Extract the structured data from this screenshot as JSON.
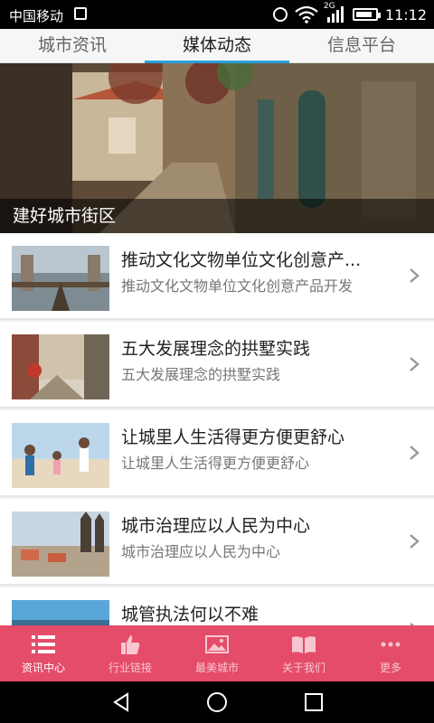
{
  "status": {
    "carrier": "中国移动",
    "network": "2G",
    "time": "11:12",
    "battery_level": 0.85
  },
  "tabs": [
    {
      "label": "城市资讯",
      "active": false
    },
    {
      "label": "媒体动态",
      "active": true
    },
    {
      "label": "信息平台",
      "active": false
    }
  ],
  "banner": {
    "caption": "建好城市街区"
  },
  "news": [
    {
      "title": "推动文化文物单位文化创意产...",
      "desc": "推动文化文物单位文化创意产品开发"
    },
    {
      "title": "五大发展理念的拱墅实践",
      "desc": "五大发展理念的拱墅实践"
    },
    {
      "title": "让城里人生活得更方便更舒心",
      "desc": "让城里人生活得更方便更舒心"
    },
    {
      "title": "城市治理应以人民为中心",
      "desc": "城市治理应以人民为中心"
    },
    {
      "title": "城管执法何以不难",
      "desc": ""
    }
  ],
  "bottom_nav": [
    {
      "label": "资讯中心",
      "icon": "list-icon",
      "active": true
    },
    {
      "label": "行业链接",
      "icon": "thumbs-up-icon",
      "active": false
    },
    {
      "label": "最美城市",
      "icon": "photo-icon",
      "active": false
    },
    {
      "label": "关于我们",
      "icon": "book-icon",
      "active": false
    },
    {
      "label": "更多",
      "icon": "more-icon",
      "active": false
    }
  ],
  "colors": {
    "accent": "#2a9fd8",
    "bottom_nav_bg": "#e44c6a"
  }
}
